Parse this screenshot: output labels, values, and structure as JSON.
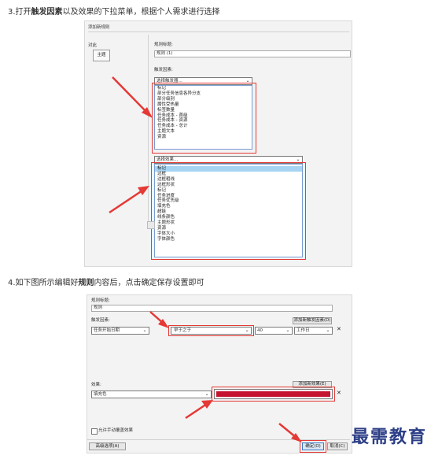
{
  "step3": {
    "prefix": "3.打开",
    "bold": "触发因素",
    "suffix": "以及效果的下拉菜单，根据个人需求进行选择"
  },
  "step4": {
    "prefix": "4.如下图所示编辑好",
    "bold": "规则",
    "suffix": "内容后，点击确定保存设置即可"
  },
  "dialog1": {
    "title": "添加新规则",
    "target_label": "对此",
    "target_button": "主题",
    "rule_title_label": "规则标题:",
    "rule_title_value": "规则 (1)",
    "trigger_label": "触发因素:",
    "trigger_select": "选择触发器...",
    "trigger_options": [
      "标记",
      "部分任务信息各异分支",
      "部分级别",
      "属性受热量",
      "标签数量",
      "任务成本 - 首级",
      "任务成本 - 资源",
      "任务成本 - 总计",
      "主题文本",
      "资源"
    ],
    "effect_select": "选择效果...",
    "effect_options": [
      "标记",
      "边框",
      "边框粗线",
      "边框形状",
      "标记",
      "任务进度",
      "任务优先级",
      "填充色",
      "超链",
      "线条颜色",
      "主题形状",
      "资源",
      "字体大小",
      "字体颜色"
    ]
  },
  "dialog2": {
    "rule_title_label": "规则标题:",
    "rule_title_value": "规则",
    "trigger_label": "触发因素:",
    "add_trigger_button": "添加新触发因素(D)",
    "trigger_field": "任务开始日期",
    "condition": "早于之于",
    "amount": "40",
    "unit": "工作日",
    "effect_label": "效果:",
    "add_effect_button": "添加新效果(E)",
    "effect_field": "填充色",
    "effect_color": "#c4122f",
    "checkbox_label": "允许手动覆盖效果",
    "advanced_button": "高级选项(A)",
    "ok_button": "确定(O)",
    "cancel_button": "取消(C)"
  },
  "watermark": "最需教育",
  "colors": {
    "annotation_red": "#e53935",
    "selection": "#a7d4f3",
    "watermark": "#2c3e86"
  }
}
